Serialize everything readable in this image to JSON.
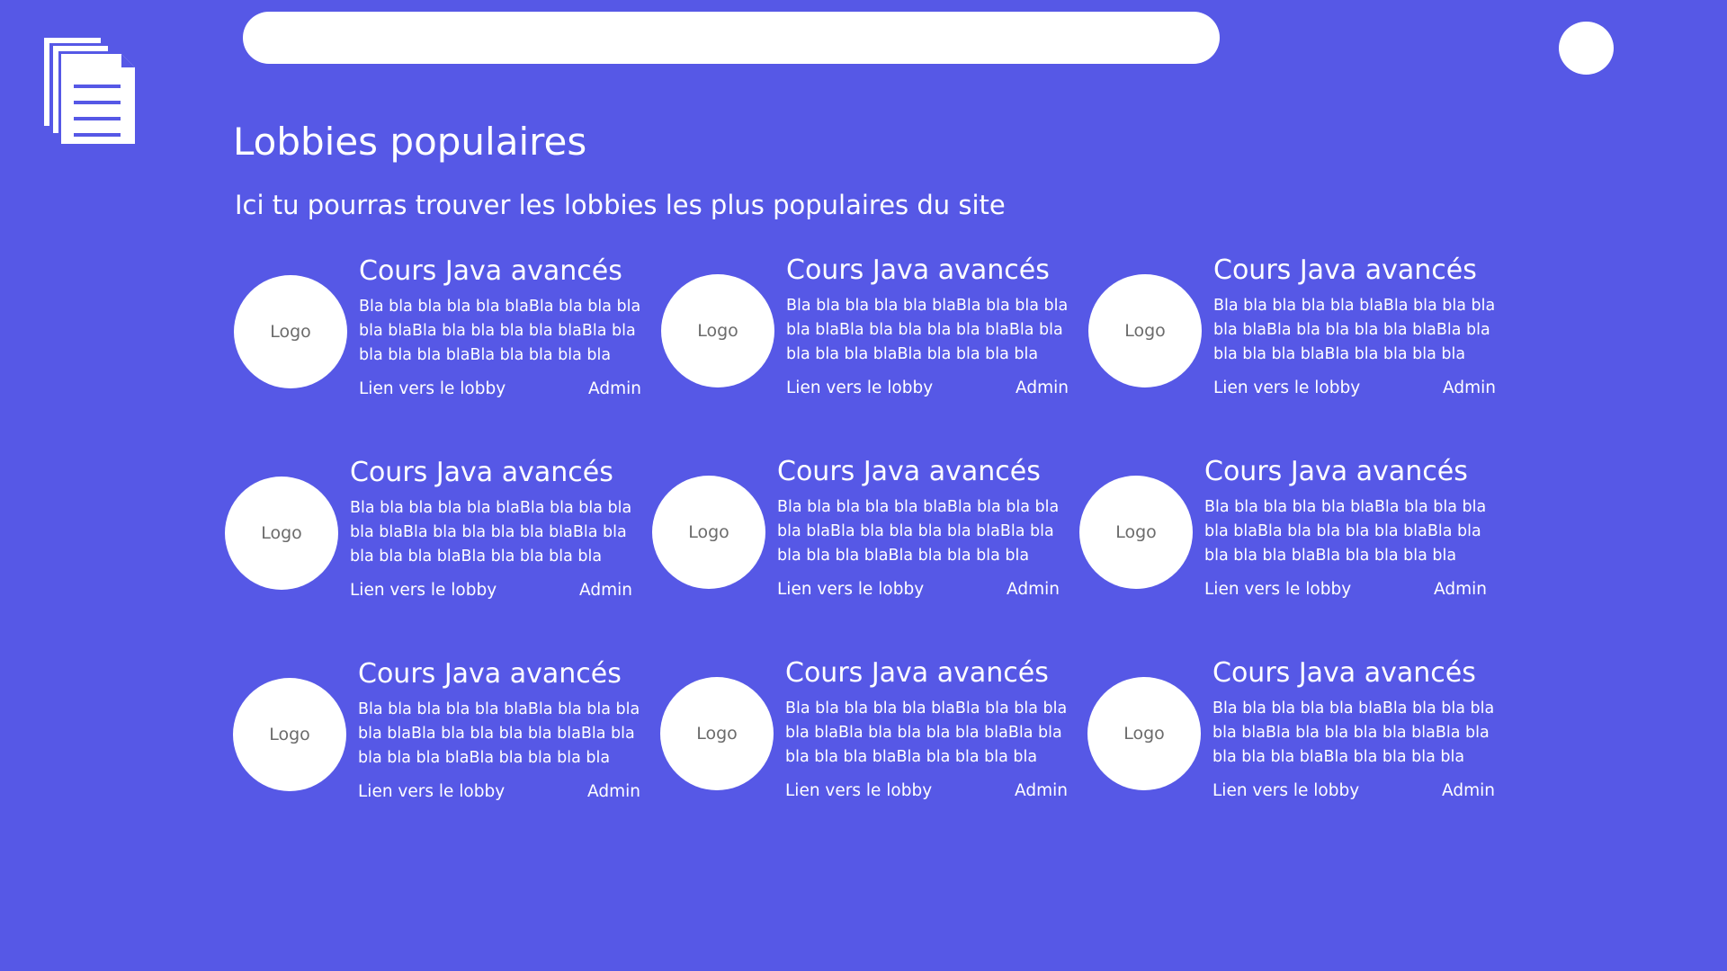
{
  "header": {
    "logo_icon": "documents-icon",
    "search": {
      "value": "",
      "placeholder": ""
    },
    "avatar_icon": "user-avatar"
  },
  "main": {
    "title": "Lobbies populaires",
    "subtitle": "Ici tu pourras trouver les lobbies les plus populaires du site"
  },
  "lobbies": [
    {
      "logo": "Logo",
      "title": "Cours Java avancés",
      "description": "Bla bla bla bla bla blaBla bla bla bla bla blaBla bla bla bla bla blaBla bla bla bla bla blaBla bla bla bla bla",
      "link": "Lien vers le lobby",
      "admin": "Admin"
    },
    {
      "logo": "Logo",
      "title": "Cours Java avancés",
      "description": "Bla bla bla bla bla blaBla bla bla bla bla blaBla bla bla bla bla blaBla bla bla bla bla blaBla bla bla bla bla",
      "link": "Lien vers le lobby",
      "admin": "Admin"
    },
    {
      "logo": "Logo",
      "title": "Cours Java avancés",
      "description": "Bla bla bla bla bla blaBla bla bla bla bla blaBla bla bla bla bla blaBla bla bla bla bla blaBla bla bla bla bla",
      "link": "Lien vers le lobby",
      "admin": "Admin"
    },
    {
      "logo": "Logo",
      "title": "Cours Java avancés",
      "description": "Bla bla bla bla bla blaBla bla bla bla bla blaBla bla bla bla bla blaBla bla bla bla bla blaBla bla bla bla bla",
      "link": "Lien vers le lobby",
      "admin": "Admin"
    },
    {
      "logo": "Logo",
      "title": "Cours Java avancés",
      "description": "Bla bla bla bla bla blaBla bla bla bla bla blaBla bla bla bla bla blaBla bla bla bla bla blaBla bla bla bla bla",
      "link": "Lien vers le lobby",
      "admin": "Admin"
    },
    {
      "logo": "Logo",
      "title": "Cours Java avancés",
      "description": "Bla bla bla bla bla blaBla bla bla bla bla blaBla bla bla bla bla blaBla bla bla bla bla blaBla bla bla bla bla",
      "link": "Lien vers le lobby",
      "admin": "Admin"
    },
    {
      "logo": "Logo",
      "title": "Cours Java avancés",
      "description": "Bla bla bla bla bla blaBla bla bla bla bla blaBla bla bla bla bla blaBla bla bla bla bla blaBla bla bla bla bla",
      "link": "Lien vers le lobby",
      "admin": "Admin"
    },
    {
      "logo": "Logo",
      "title": "Cours Java avancés",
      "description": "Bla bla bla bla bla blaBla bla bla bla bla blaBla bla bla bla bla blaBla bla bla bla bla blaBla bla bla bla bla",
      "link": "Lien vers le lobby",
      "admin": "Admin"
    },
    {
      "logo": "Logo",
      "title": "Cours Java avancés",
      "description": "Bla bla bla bla bla blaBla bla bla bla bla blaBla bla bla bla bla blaBla bla bla bla bla blaBla bla bla bla bla",
      "link": "Lien vers le lobby",
      "admin": "Admin"
    }
  ]
}
